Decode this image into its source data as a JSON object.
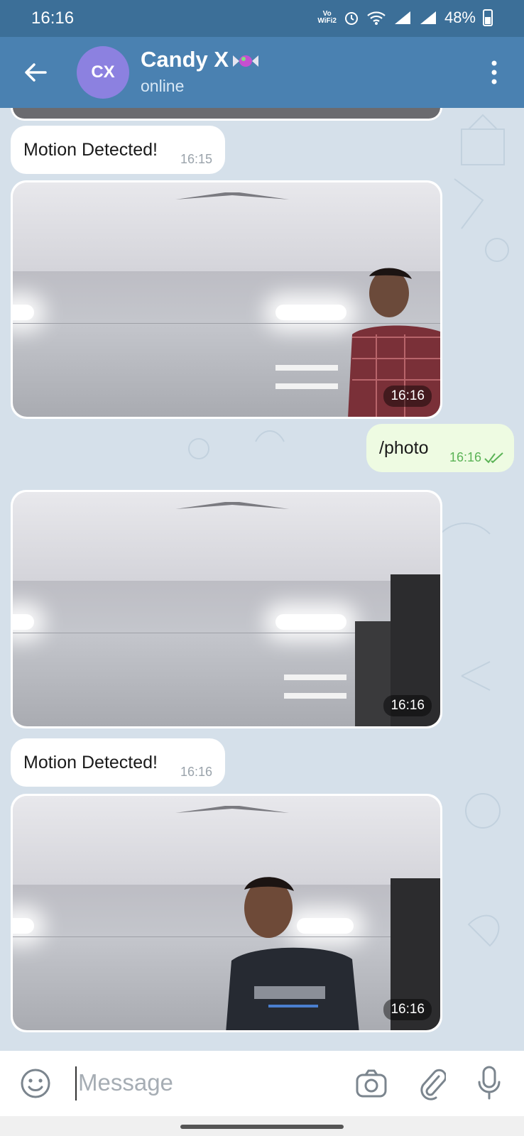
{
  "status_bar": {
    "time": "16:16",
    "vowifi": "Vo\nWiFi2",
    "battery": "48%"
  },
  "header": {
    "avatar_initials": "CX",
    "title": "Candy X",
    "subtitle": "online"
  },
  "messages": [
    {
      "type": "text",
      "direction": "in",
      "text": "Motion Detected!",
      "time": "16:15"
    },
    {
      "type": "photo",
      "direction": "in",
      "time": "16:16"
    },
    {
      "type": "text",
      "direction": "out",
      "text": "/photo",
      "time": "16:16",
      "read": true
    },
    {
      "type": "photo",
      "direction": "in",
      "time": "16:16"
    },
    {
      "type": "text",
      "direction": "in",
      "text": "Motion Detected!",
      "time": "16:16"
    },
    {
      "type": "photo",
      "direction": "in",
      "time": "16:16"
    }
  ],
  "input": {
    "placeholder": "Message"
  },
  "colors": {
    "header": "#4a81b1",
    "statusbar": "#3c6f98",
    "avatar": "#8c81e0",
    "chat_bg": "#d5e0ea",
    "outgoing_bubble": "#eefbe2",
    "check": "#5bb356"
  },
  "icons": {
    "back": "arrow-left-icon",
    "menu": "more-vertical-icon",
    "emoji": "emoji-icon",
    "camera": "camera-icon",
    "attach": "paperclip-icon",
    "mic": "microphone-icon"
  }
}
